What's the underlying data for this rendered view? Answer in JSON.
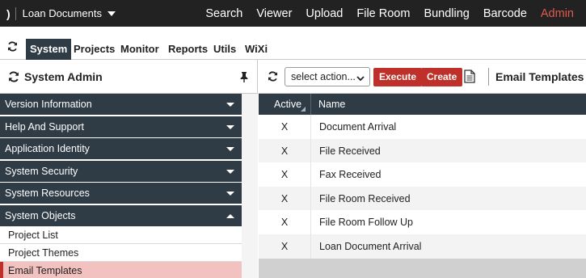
{
  "app": {
    "brand_name": "Loan Documents",
    "nav": [
      {
        "label": "Search",
        "active": false
      },
      {
        "label": "Viewer",
        "active": false
      },
      {
        "label": "Upload",
        "active": false
      },
      {
        "label": "File Room",
        "active": false
      },
      {
        "label": "Bundling",
        "active": false
      },
      {
        "label": "Barcode",
        "active": false
      },
      {
        "label": "Admin",
        "active": true
      }
    ],
    "accent_color": "#e05a4f"
  },
  "tabs": [
    {
      "label": "System",
      "active": true
    },
    {
      "label": "Projects",
      "active": false
    },
    {
      "label": "Monitor",
      "active": false
    },
    {
      "label": "Reports",
      "active": false
    },
    {
      "label": "Utils",
      "active": false
    },
    {
      "label": "WiXi",
      "active": false
    }
  ],
  "sidebar": {
    "title": "System Admin",
    "sections": [
      {
        "label": "Version Information",
        "expanded": false
      },
      {
        "label": "Help And Support",
        "expanded": false
      },
      {
        "label": "Application Identity",
        "expanded": false
      },
      {
        "label": "System Security",
        "expanded": false
      },
      {
        "label": "System Resources",
        "expanded": false
      },
      {
        "label": "System Objects",
        "expanded": true
      }
    ],
    "sub_items": [
      {
        "label": "Project List",
        "selected": false
      },
      {
        "label": "Project Themes",
        "selected": false
      },
      {
        "label": "Email Templates",
        "selected": true
      }
    ],
    "header_color": "#2f3b45",
    "selected_color": "#f2c2c0"
  },
  "toolbar": {
    "select_placeholder": "select action...",
    "execute_label": "Execute",
    "create_label": "Create",
    "panel_title": "Email Templates",
    "button_color": "#c0302a"
  },
  "grid": {
    "columns": [
      "Active",
      "Name"
    ],
    "rows": [
      {
        "active": "X",
        "name": "Document Arrival"
      },
      {
        "active": "X",
        "name": "File Received"
      },
      {
        "active": "X",
        "name": "Fax Received"
      },
      {
        "active": "X",
        "name": "File Room Received"
      },
      {
        "active": "X",
        "name": "File Room Follow Up"
      },
      {
        "active": "X",
        "name": "Loan Document Arrival"
      }
    ]
  }
}
